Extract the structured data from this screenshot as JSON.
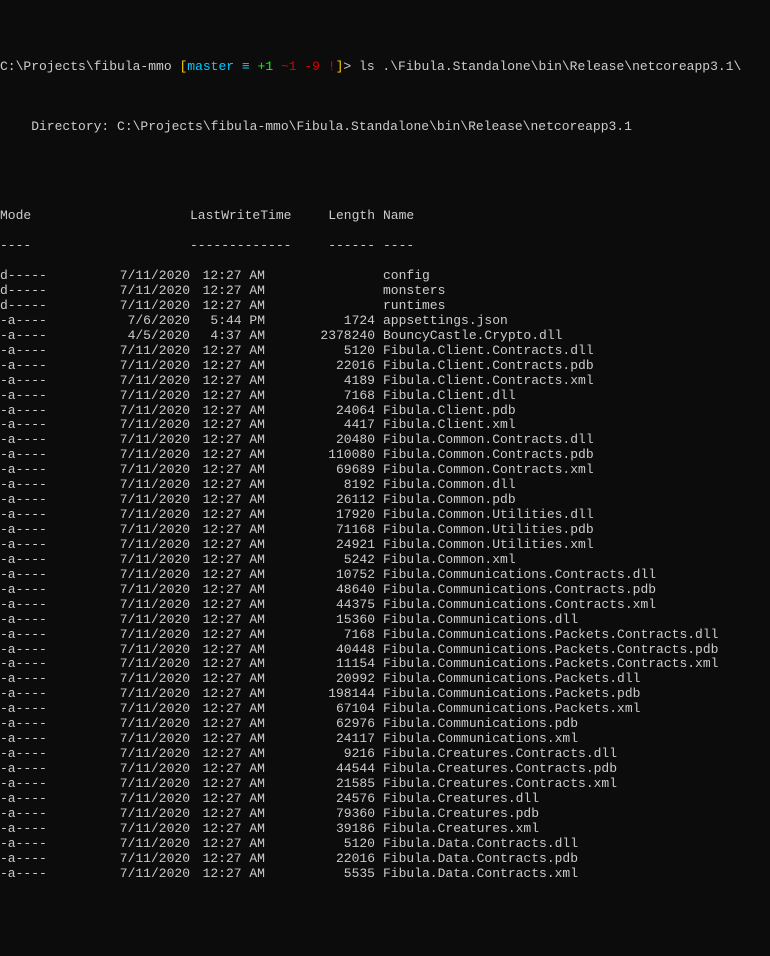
{
  "prompt": {
    "path": "C:\\Projects\\fibula-mmo",
    "branch": "master",
    "eq": "≡",
    "git_plus": "+1",
    "git_tilde": "~1",
    "git_minus": "-9",
    "git_bang": "!",
    "bracket_open": "[",
    "bracket_close": "]",
    "arrow": ">",
    "command": "ls .\\Fibula.Standalone\\bin\\Release\\netcoreapp3.1\\"
  },
  "directory_label": "    Directory: C:\\Projects\\fibula-mmo\\Fibula.Standalone\\bin\\Release\\netcoreapp3.1",
  "headers": {
    "mode": "Mode",
    "lastwrite": "LastWriteTime",
    "length": "Length",
    "name": "Name"
  },
  "dashes": {
    "mode": "----",
    "lastwrite": "-------------",
    "length": "------",
    "name": "----"
  },
  "rows": [
    {
      "mode": "d-----",
      "date": "7/11/2020",
      "time": "12:27 AM",
      "length": "",
      "name": "config"
    },
    {
      "mode": "d-----",
      "date": "7/11/2020",
      "time": "12:27 AM",
      "length": "",
      "name": "monsters"
    },
    {
      "mode": "d-----",
      "date": "7/11/2020",
      "time": "12:27 AM",
      "length": "",
      "name": "runtimes"
    },
    {
      "mode": "-a----",
      "date": "7/6/2020",
      "time": "5:44 PM",
      "length": "1724",
      "name": "appsettings.json"
    },
    {
      "mode": "-a----",
      "date": "4/5/2020",
      "time": "4:37 AM",
      "length": "2378240",
      "name": "BouncyCastle.Crypto.dll"
    },
    {
      "mode": "-a----",
      "date": "7/11/2020",
      "time": "12:27 AM",
      "length": "5120",
      "name": "Fibula.Client.Contracts.dll"
    },
    {
      "mode": "-a----",
      "date": "7/11/2020",
      "time": "12:27 AM",
      "length": "22016",
      "name": "Fibula.Client.Contracts.pdb"
    },
    {
      "mode": "-a----",
      "date": "7/11/2020",
      "time": "12:27 AM",
      "length": "4189",
      "name": "Fibula.Client.Contracts.xml"
    },
    {
      "mode": "-a----",
      "date": "7/11/2020",
      "time": "12:27 AM",
      "length": "7168",
      "name": "Fibula.Client.dll"
    },
    {
      "mode": "-a----",
      "date": "7/11/2020",
      "time": "12:27 AM",
      "length": "24064",
      "name": "Fibula.Client.pdb"
    },
    {
      "mode": "-a----",
      "date": "7/11/2020",
      "time": "12:27 AM",
      "length": "4417",
      "name": "Fibula.Client.xml"
    },
    {
      "mode": "-a----",
      "date": "7/11/2020",
      "time": "12:27 AM",
      "length": "20480",
      "name": "Fibula.Common.Contracts.dll"
    },
    {
      "mode": "-a----",
      "date": "7/11/2020",
      "time": "12:27 AM",
      "length": "110080",
      "name": "Fibula.Common.Contracts.pdb"
    },
    {
      "mode": "-a----",
      "date": "7/11/2020",
      "time": "12:27 AM",
      "length": "69689",
      "name": "Fibula.Common.Contracts.xml"
    },
    {
      "mode": "-a----",
      "date": "7/11/2020",
      "time": "12:27 AM",
      "length": "8192",
      "name": "Fibula.Common.dll"
    },
    {
      "mode": "-a----",
      "date": "7/11/2020",
      "time": "12:27 AM",
      "length": "26112",
      "name": "Fibula.Common.pdb"
    },
    {
      "mode": "-a----",
      "date": "7/11/2020",
      "time": "12:27 AM",
      "length": "17920",
      "name": "Fibula.Common.Utilities.dll"
    },
    {
      "mode": "-a----",
      "date": "7/11/2020",
      "time": "12:27 AM",
      "length": "71168",
      "name": "Fibula.Common.Utilities.pdb"
    },
    {
      "mode": "-a----",
      "date": "7/11/2020",
      "time": "12:27 AM",
      "length": "24921",
      "name": "Fibula.Common.Utilities.xml"
    },
    {
      "mode": "-a----",
      "date": "7/11/2020",
      "time": "12:27 AM",
      "length": "5242",
      "name": "Fibula.Common.xml"
    },
    {
      "mode": "-a----",
      "date": "7/11/2020",
      "time": "12:27 AM",
      "length": "10752",
      "name": "Fibula.Communications.Contracts.dll"
    },
    {
      "mode": "-a----",
      "date": "7/11/2020",
      "time": "12:27 AM",
      "length": "48640",
      "name": "Fibula.Communications.Contracts.pdb"
    },
    {
      "mode": "-a----",
      "date": "7/11/2020",
      "time": "12:27 AM",
      "length": "44375",
      "name": "Fibula.Communications.Contracts.xml"
    },
    {
      "mode": "-a----",
      "date": "7/11/2020",
      "time": "12:27 AM",
      "length": "15360",
      "name": "Fibula.Communications.dll"
    },
    {
      "mode": "-a----",
      "date": "7/11/2020",
      "time": "12:27 AM",
      "length": "7168",
      "name": "Fibula.Communications.Packets.Contracts.dll"
    },
    {
      "mode": "-a----",
      "date": "7/11/2020",
      "time": "12:27 AM",
      "length": "40448",
      "name": "Fibula.Communications.Packets.Contracts.pdb"
    },
    {
      "mode": "-a----",
      "date": "7/11/2020",
      "time": "12:27 AM",
      "length": "11154",
      "name": "Fibula.Communications.Packets.Contracts.xml"
    },
    {
      "mode": "-a----",
      "date": "7/11/2020",
      "time": "12:27 AM",
      "length": "20992",
      "name": "Fibula.Communications.Packets.dll"
    },
    {
      "mode": "-a----",
      "date": "7/11/2020",
      "time": "12:27 AM",
      "length": "198144",
      "name": "Fibula.Communications.Packets.pdb"
    },
    {
      "mode": "-a----",
      "date": "7/11/2020",
      "time": "12:27 AM",
      "length": "67104",
      "name": "Fibula.Communications.Packets.xml"
    },
    {
      "mode": "-a----",
      "date": "7/11/2020",
      "time": "12:27 AM",
      "length": "62976",
      "name": "Fibula.Communications.pdb"
    },
    {
      "mode": "-a----",
      "date": "7/11/2020",
      "time": "12:27 AM",
      "length": "24117",
      "name": "Fibula.Communications.xml"
    },
    {
      "mode": "-a----",
      "date": "7/11/2020",
      "time": "12:27 AM",
      "length": "9216",
      "name": "Fibula.Creatures.Contracts.dll"
    },
    {
      "mode": "-a----",
      "date": "7/11/2020",
      "time": "12:27 AM",
      "length": "44544",
      "name": "Fibula.Creatures.Contracts.pdb"
    },
    {
      "mode": "-a----",
      "date": "7/11/2020",
      "time": "12:27 AM",
      "length": "21585",
      "name": "Fibula.Creatures.Contracts.xml"
    },
    {
      "mode": "-a----",
      "date": "7/11/2020",
      "time": "12:27 AM",
      "length": "24576",
      "name": "Fibula.Creatures.dll"
    },
    {
      "mode": "-a----",
      "date": "7/11/2020",
      "time": "12:27 AM",
      "length": "79360",
      "name": "Fibula.Creatures.pdb"
    },
    {
      "mode": "-a----",
      "date": "7/11/2020",
      "time": "12:27 AM",
      "length": "39186",
      "name": "Fibula.Creatures.xml"
    },
    {
      "mode": "-a----",
      "date": "7/11/2020",
      "time": "12:27 AM",
      "length": "5120",
      "name": "Fibula.Data.Contracts.dll"
    },
    {
      "mode": "-a----",
      "date": "7/11/2020",
      "time": "12:27 AM",
      "length": "22016",
      "name": "Fibula.Data.Contracts.pdb"
    },
    {
      "mode": "-a----",
      "date": "7/11/2020",
      "time": "12:27 AM",
      "length": "5535",
      "name": "Fibula.Data.Contracts.xml"
    }
  ]
}
